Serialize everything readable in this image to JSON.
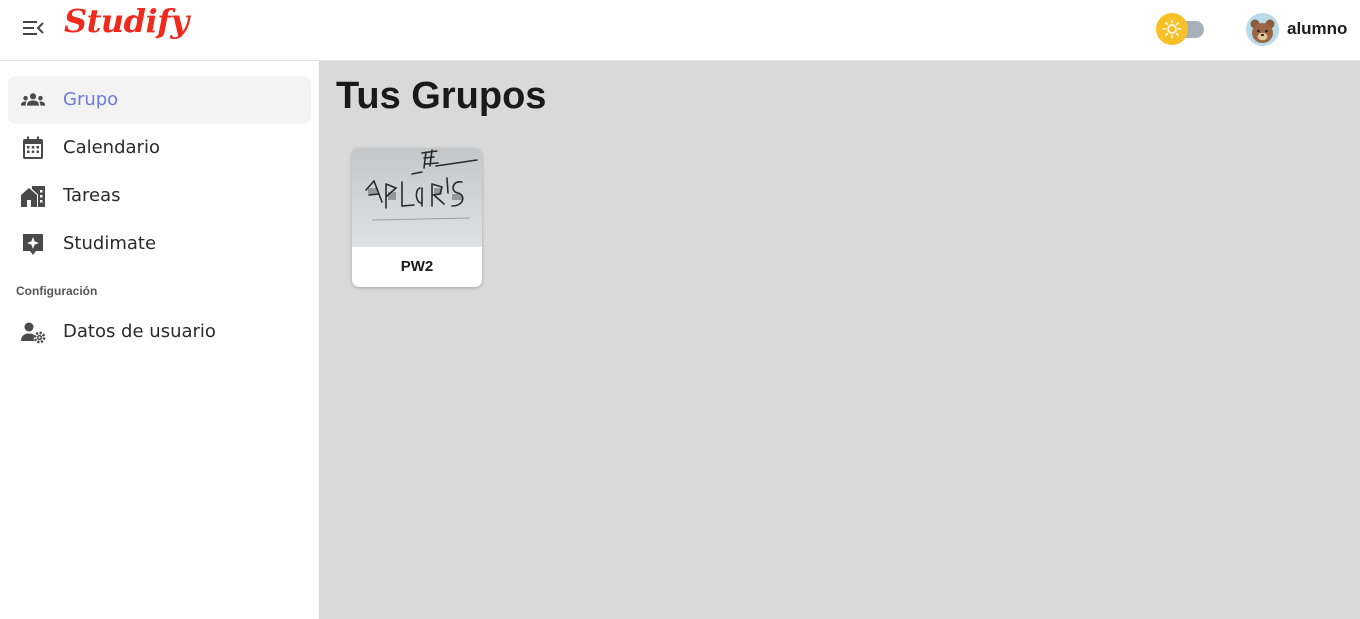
{
  "header": {
    "logo_text": "Studify",
    "menu_toggle_icon": "menu-collapse-icon",
    "theme_icon": "sun-icon",
    "theme_knob_color": "#f8bf26",
    "theme_track_color": "#a6b0bd",
    "user_name": "alumno",
    "avatar_icon": "bear-avatar-icon",
    "brand_color": "#ef2a1c"
  },
  "sidebar": {
    "accent_color": "#6b7bdc",
    "items": [
      {
        "label": "Grupo",
        "icon": "users-group-icon",
        "active": true
      },
      {
        "label": "Calendario",
        "icon": "calendar-icon",
        "active": false
      },
      {
        "label": "Tareas",
        "icon": "buildings-icon",
        "active": false
      },
      {
        "label": "Studimate",
        "icon": "sparkle-chat-icon",
        "active": false
      }
    ],
    "section_heading": "Configuración",
    "settings_items": [
      {
        "label": "Datos de usuario",
        "icon": "user-gear-icon",
        "active": false
      }
    ]
  },
  "main": {
    "title": "Tus Grupos",
    "background": "#d9d9d9",
    "groups": [
      {
        "name": "PW2",
        "thumbnail": "handwritten-sketch-photo"
      }
    ]
  }
}
